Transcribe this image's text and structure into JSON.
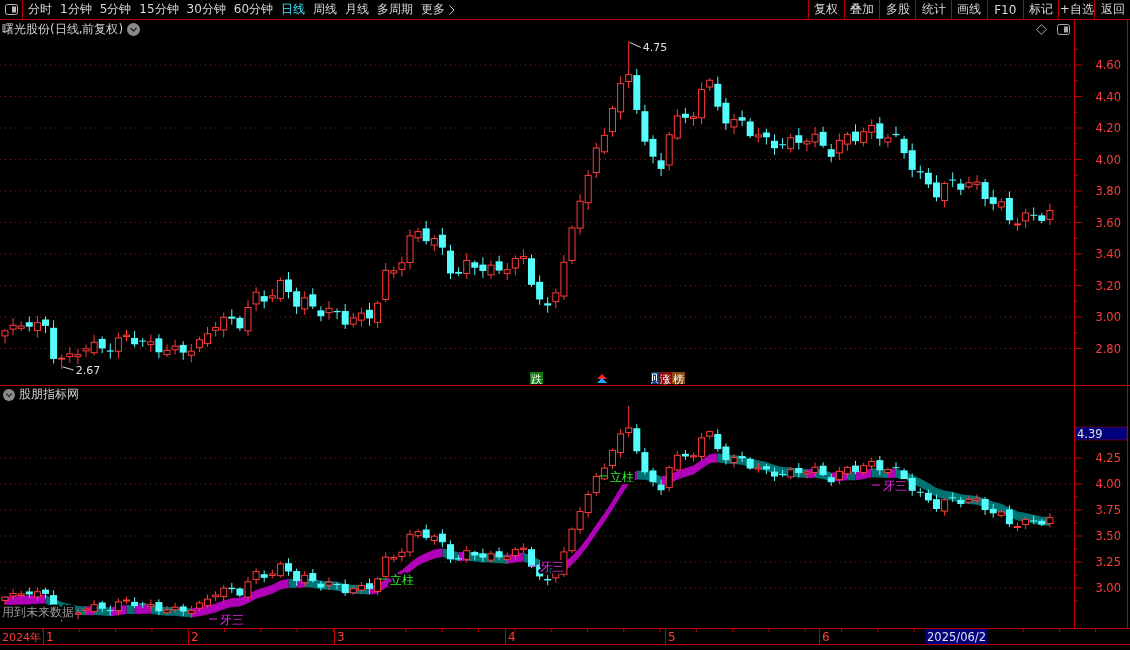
{
  "toolbar": {
    "periods": [
      {
        "label": "分时",
        "selected": false
      },
      {
        "label": "1分钟",
        "selected": false
      },
      {
        "label": "5分钟",
        "selected": false
      },
      {
        "label": "15分钟",
        "selected": false
      },
      {
        "label": "30分钟",
        "selected": false
      },
      {
        "label": "60分钟",
        "selected": false
      },
      {
        "label": "日线",
        "selected": true
      },
      {
        "label": "周线",
        "selected": false
      },
      {
        "label": "月线",
        "selected": false
      },
      {
        "label": "多周期",
        "selected": false
      }
    ],
    "more": "更多",
    "actions": [
      "复权",
      "叠加",
      "多股",
      "统计",
      "画线",
      "F10",
      "标记",
      "+自选",
      "返回"
    ]
  },
  "price_panel": {
    "title": "曙光股份(日线,前复权)",
    "y_ticks": [
      "4.60",
      "4.40",
      "4.20",
      "4.00",
      "3.80",
      "3.60",
      "3.40",
      "3.20",
      "3.00",
      "2.80"
    ],
    "high_label": "4.75",
    "low_label": "2.67",
    "signals": [
      {
        "kind": "tag",
        "text": "跌",
        "color": "#107c10"
      },
      {
        "kind": "arrows"
      },
      {
        "kind": "stub",
        "color": "#123c7a"
      },
      {
        "kind": "tag",
        "text": "涨",
        "color": "#8c0a0a"
      },
      {
        "kind": "tag",
        "text": "榜",
        "color": "#8a4a12"
      }
    ]
  },
  "indicator_panel": {
    "title": "股朋指标网",
    "current_value": "4.39",
    "y_ticks": [
      "4.25",
      "4.00",
      "3.75",
      "3.50",
      "3.25",
      "3.00"
    ],
    "markers": [
      {
        "kind": "tooth",
        "text": "牙三"
      },
      {
        "kind": "pillar",
        "text": "立柱"
      },
      {
        "kind": "tooth",
        "text": "牙三"
      },
      {
        "kind": "pillar",
        "text": "立柱"
      },
      {
        "kind": "tooth",
        "text": "牙三"
      }
    ],
    "note": "用到未来数据"
  },
  "date_axis": {
    "year": "2024年",
    "months": [
      "1",
      "2",
      "3",
      "4",
      "5",
      "6"
    ],
    "cursor_date": "2025/06/2"
  }
}
